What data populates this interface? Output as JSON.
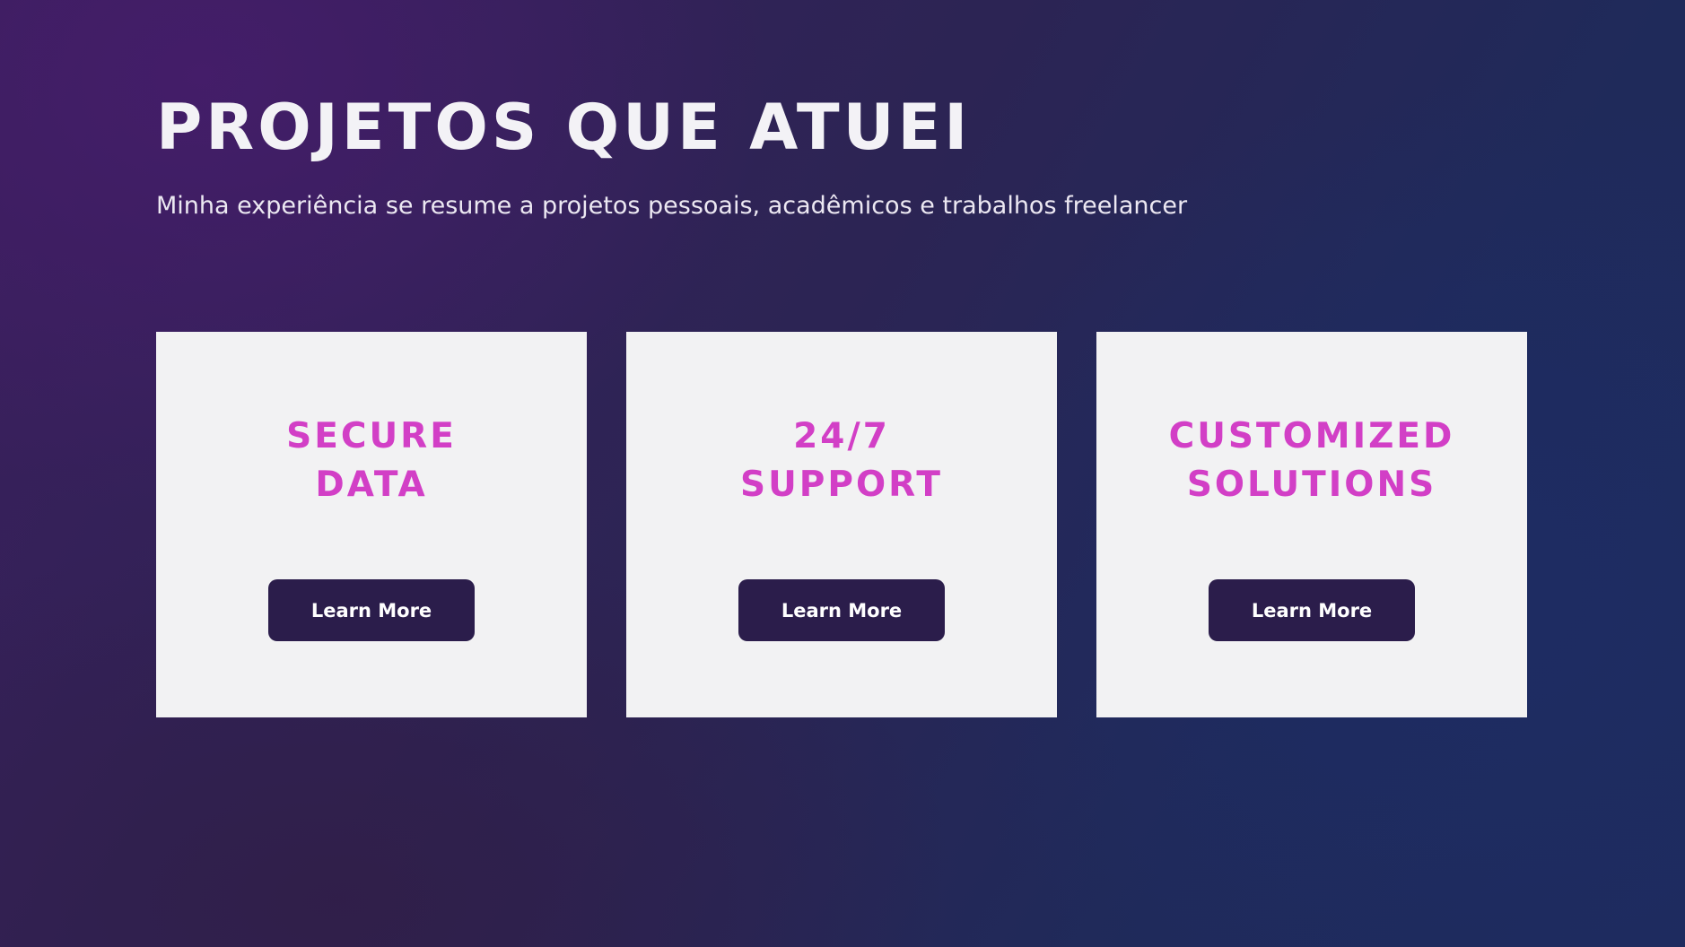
{
  "hero": {
    "title": "PROJETOS QUE ATUEI",
    "subtitle": "Minha experiência se resume a projetos pessoais, acadêmicos e trabalhos freelancer"
  },
  "cards": [
    {
      "title_line1": "SECURE",
      "title_line2": "DATA",
      "button_label": "Learn More"
    },
    {
      "title_line1": "24/7",
      "title_line2": "SUPPORT",
      "button_label": "Learn More"
    },
    {
      "title_line1": "CUSTOMIZED",
      "title_line2": "SOLUTIONS",
      "button_label": "Learn More"
    }
  ],
  "colors": {
    "card_title": "#d23fc6",
    "button_bg": "#2b1d4b",
    "card_bg": "#f2f2f3"
  }
}
